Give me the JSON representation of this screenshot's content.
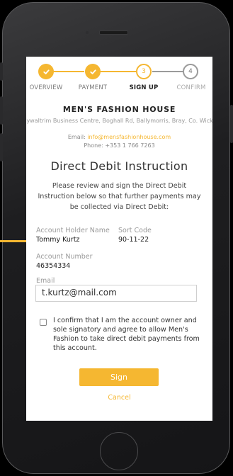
{
  "stepper": {
    "steps": [
      {
        "label": "OVERVIEW",
        "number": "",
        "state": "done"
      },
      {
        "label": "PAYMENT",
        "number": "",
        "state": "done"
      },
      {
        "label": "SIGN UP",
        "number": "3",
        "state": "current"
      },
      {
        "label": "CONFIRM",
        "number": "4",
        "state": "todo"
      }
    ]
  },
  "company": {
    "name": "MEN'S FASHION HOUSE",
    "address": "Ballywaltrim Business Centre, Boghall Rd, Ballymorris, Bray, Co. Wicklow",
    "email_label": "Email: ",
    "email": "info@mensfashionhouse.com",
    "phone": "Phone: +353 1 766 7263"
  },
  "form": {
    "title": "Direct Debit Instruction",
    "intro": "Please review and sign the Direct Debit Instruction below so that further payments may be collected via Direct Debit:",
    "account_holder_label": "Account Holder Name",
    "account_holder_value": "Tommy Kurtz",
    "sort_code_label": "Sort Code",
    "sort_code_value": "90-11-22",
    "account_number_label": "Account Number",
    "account_number_value": "46354334",
    "email_label": "Email",
    "email_value": "t.kurtz@mail.com",
    "consent_text": "I confirm that I am the account owner and sole signatory and agree to allow Men's Fashion to take direct debit payments from this account.",
    "consent_checked": false,
    "sign_label": "Sign",
    "cancel_label": "Cancel"
  },
  "colors": {
    "accent": "#f5b731",
    "inactive": "#9a9a9a"
  }
}
